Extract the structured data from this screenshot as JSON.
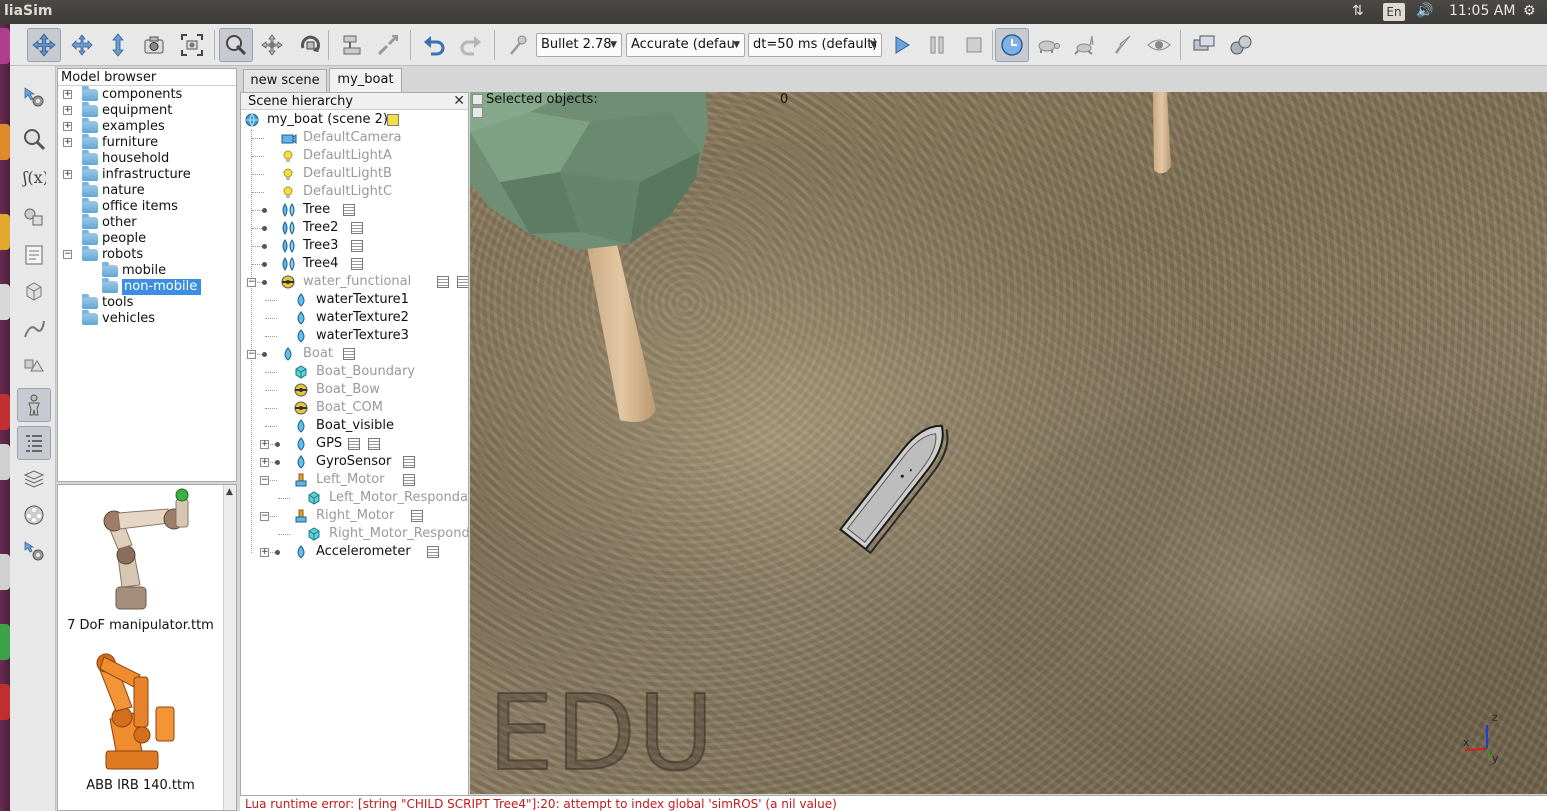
{
  "topbar": {
    "app_title": "liaSim",
    "language": "En",
    "time": "11:05 AM",
    "icons": [
      "network-arrows-icon",
      "language-icon",
      "volume-icon",
      "power-gear-icon"
    ]
  },
  "toolbar": {
    "physics_engine": "Bullet 2.78",
    "accuracy": "Accurate (defau",
    "timestep": "dt=50 ms (default)"
  },
  "model_browser": {
    "title": "Model browser",
    "items": [
      {
        "label": "components",
        "expandable": true
      },
      {
        "label": "equipment",
        "expandable": true
      },
      {
        "label": "examples",
        "expandable": true
      },
      {
        "label": "furniture",
        "expandable": true
      },
      {
        "label": "household",
        "expandable": false
      },
      {
        "label": "infrastructure",
        "expandable": true
      },
      {
        "label": "nature",
        "expandable": false
      },
      {
        "label": "office items",
        "expandable": false
      },
      {
        "label": "other",
        "expandable": false
      },
      {
        "label": "people",
        "expandable": false
      },
      {
        "label": "robots",
        "expandable": true,
        "expanded": true
      },
      {
        "label": "mobile",
        "child": true
      },
      {
        "label": "non-mobile",
        "child": true,
        "selected": true
      },
      {
        "label": "tools",
        "expandable": false
      },
      {
        "label": "vehicles",
        "expandable": false
      }
    ],
    "preview_items": [
      "7 DoF manipulator.ttm",
      "ABB IRB 140.ttm"
    ]
  },
  "tabs": [
    "new scene",
    "my_boat"
  ],
  "active_tab": "my_boat",
  "hierarchy": {
    "title": "Scene hierarchy",
    "root": "my_boat (scene 2)",
    "items": [
      {
        "label": "DefaultCamera",
        "dim": true
      },
      {
        "label": "DefaultLightA",
        "dim": true
      },
      {
        "label": "DefaultLightB",
        "dim": true
      },
      {
        "label": "DefaultLightC",
        "dim": true
      },
      {
        "label": "Tree",
        "dim": false
      },
      {
        "label": "Tree2",
        "dim": false
      },
      {
        "label": "Tree3",
        "dim": false
      },
      {
        "label": "Tree4",
        "dim": false
      },
      {
        "label": "water_functional",
        "dim": true
      },
      {
        "label": "waterTexture1",
        "dim": false
      },
      {
        "label": "waterTexture2",
        "dim": false
      },
      {
        "label": "waterTexture3",
        "dim": false
      },
      {
        "label": "Boat",
        "dim": true
      },
      {
        "label": "Boat_Boundary",
        "dim": true
      },
      {
        "label": "Boat_Bow",
        "dim": true
      },
      {
        "label": "Boat_COM",
        "dim": true
      },
      {
        "label": "Boat_visible",
        "dim": false
      },
      {
        "label": "GPS",
        "dim": false
      },
      {
        "label": "GyroSensor",
        "dim": false
      },
      {
        "label": "Left_Motor",
        "dim": true
      },
      {
        "label": "Left_Motor_Respondab",
        "dim": true
      },
      {
        "label": "Right_Motor",
        "dim": true
      },
      {
        "label": "Right_Motor_Responda",
        "dim": true
      },
      {
        "label": "Accelerometer",
        "dim": false
      }
    ]
  },
  "viewport": {
    "selected_label": "Selected objects:",
    "selected_count": "0",
    "watermark": "EDU",
    "axes": {
      "x": "x",
      "y": "y",
      "z": "z"
    }
  },
  "status": {
    "message": "Lua runtime error: [string \"CHILD SCRIPT Tree4\"]:20: attempt to index global 'simROS' (a nil value)"
  },
  "colors": {
    "selection": "#3d8ee0",
    "error_text": "#c41818",
    "tree_foliage": "#6f8e74",
    "tree_trunk": "#d9bc96"
  }
}
